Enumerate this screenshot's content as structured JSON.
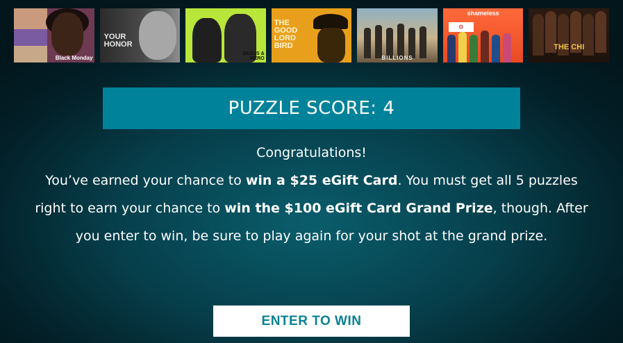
{
  "posters": [
    {
      "title": "Black Monday",
      "bg": "#6d3a52"
    },
    {
      "title": "YOUR HONOR",
      "bg": "#4a4a4a"
    },
    {
      "title": "DESUS & MERO",
      "bg": "#b8e63a"
    },
    {
      "title": "THE GOOD LORD BIRD",
      "bg": "#e8a01c"
    },
    {
      "title": "BILLIONS",
      "bg": "#c8b48e"
    },
    {
      "title": "shameless",
      "bg": "#e94a24"
    },
    {
      "title": "THE CHI",
      "bg": "#1d120c"
    }
  ],
  "score": {
    "label": "PUZZLE SCORE: 4"
  },
  "message": {
    "congrats": "Congratulations!",
    "line1_before": "You’ve earned your chance to ",
    "line1_bold": "win a $25 eGift Card",
    "line1_after": ". You must get all 5 puzzles right to earn your chance to ",
    "line2_bold": "win the $100 eGift Card Grand Prize",
    "line2_after": ", though. After you enter to win, be sure to play again for your shot at the grand prize."
  },
  "cta": {
    "label": "ENTER TO WIN"
  },
  "colors": {
    "accent": "#00839a",
    "button_text": "#0a8293",
    "background": "#063f4b"
  }
}
